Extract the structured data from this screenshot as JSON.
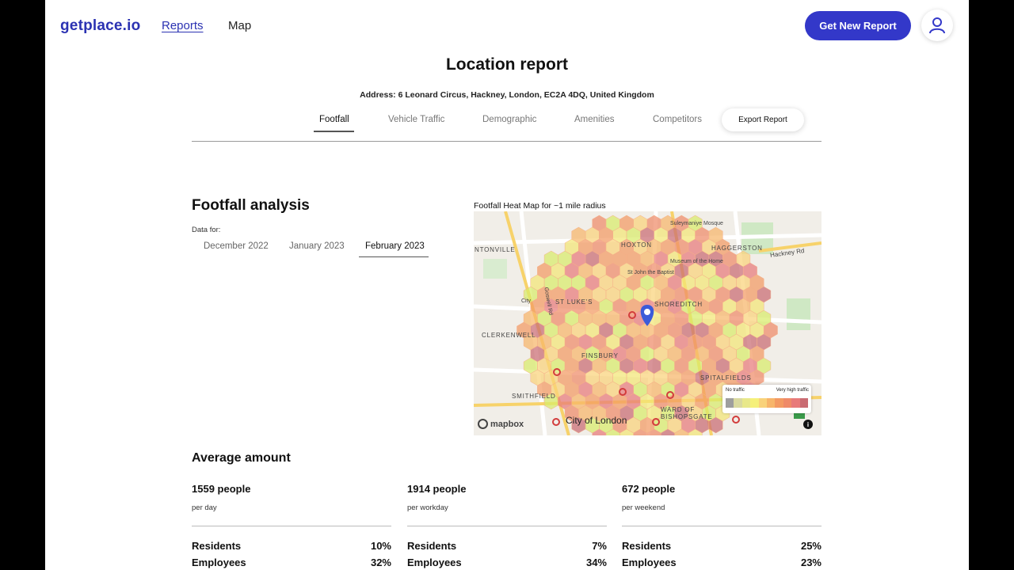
{
  "header": {
    "logo": "getplace.io",
    "nav": {
      "reports": "Reports",
      "map": "Map"
    },
    "cta_label": "Get New Report"
  },
  "report": {
    "title": "Location report",
    "address": "Address: 6 Leonard Circus, Hackney, London, EC2A 4DQ, United Kingdom",
    "tabs": [
      "Footfall",
      "Vehicle Traffic",
      "Demographic",
      "Amenities",
      "Competitors"
    ],
    "active_tab": "Footfall",
    "export_label": "Export Report"
  },
  "footfall": {
    "title": "Footfall analysis",
    "data_for_label": "Data for:",
    "months": [
      "December 2022",
      "January 2023",
      "February 2023"
    ],
    "active_month": "February 2023"
  },
  "map": {
    "title": "Footfall Heat Map for ~1 mile radius",
    "legend_low": "No traffic",
    "legend_high": "Very high traffic",
    "legend_colors": [
      "#9e9e9e",
      "#d9d9a0",
      "#e8e88a",
      "#f5f07a",
      "#f9d27a",
      "#f7b56a",
      "#f39a62",
      "#ef8a68",
      "#e87a7a",
      "#c96b72"
    ],
    "attribution": "mapbox",
    "labels": {
      "hoxton": "HOXTON",
      "haggerston": "HAGGERSTON",
      "shoreditch": "SHOREDITCH",
      "st_lukes": "ST LUKE'S",
      "clerkenwell": "CLERKENWELL",
      "finsbury": "FINSBURY",
      "spitalfields": "SPITALFIELDS",
      "smithfield": "SMITHFIELD",
      "city_of_london": "City of London",
      "bishopsgate": "WARD OF BISHOPSGATE",
      "pentonville": "NTONVILLE",
      "hackney_rd": "Hackney Rd",
      "goswell_rd": "Goswell Rd",
      "museum": "Museum of the Home",
      "st_john": "St John the Baptist",
      "mosque": "Suleymaniye Mosque",
      "city_rd": "City"
    }
  },
  "average": {
    "title": "Average amount",
    "stats": [
      {
        "value": "1559 people",
        "period": "per day",
        "residents": "10%",
        "employees": "32%"
      },
      {
        "value": "1914 people",
        "period": "per workday",
        "residents": "7%",
        "employees": "34%"
      },
      {
        "value": "672 people",
        "period": "per weekend",
        "residents": "25%",
        "employees": "23%"
      }
    ],
    "residents_label": "Residents",
    "employees_label": "Employees"
  }
}
